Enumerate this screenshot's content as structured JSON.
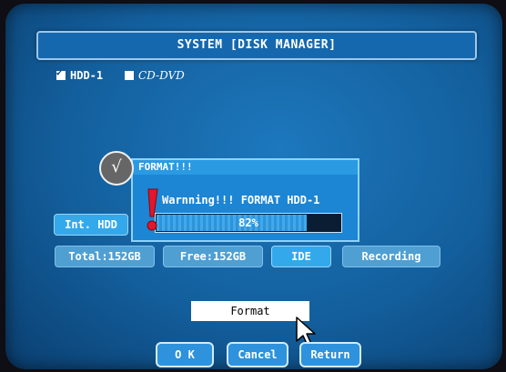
{
  "window": {
    "title": "SYSTEM [DISK MANAGER]"
  },
  "disks": [
    {
      "label": "HDD-1",
      "checked": true
    },
    {
      "label": "CD-DVD",
      "checked": false
    }
  ],
  "drive_tab": {
    "label": "Int. HDD"
  },
  "info": {
    "total": "Total:152GB",
    "free": "Free:152GB",
    "interface": "IDE",
    "usage": "Recording"
  },
  "dialog": {
    "badge_icon": "checkmark-badge-icon",
    "badge_symbol": "√",
    "title": "FORMAT!!!",
    "message": "Warnning!!! FORMAT HDD-1",
    "warning_icon": "exclamation-icon",
    "progress_percent": 82,
    "progress_label": "82%"
  },
  "format_button": {
    "label": "Format"
  },
  "bottom_buttons": {
    "ok": "O K",
    "cancel": "Cancel",
    "return": "Return"
  },
  "colors": {
    "screen": "#135f9d",
    "accent": "#33a9ec",
    "warning": "#e3162b"
  }
}
